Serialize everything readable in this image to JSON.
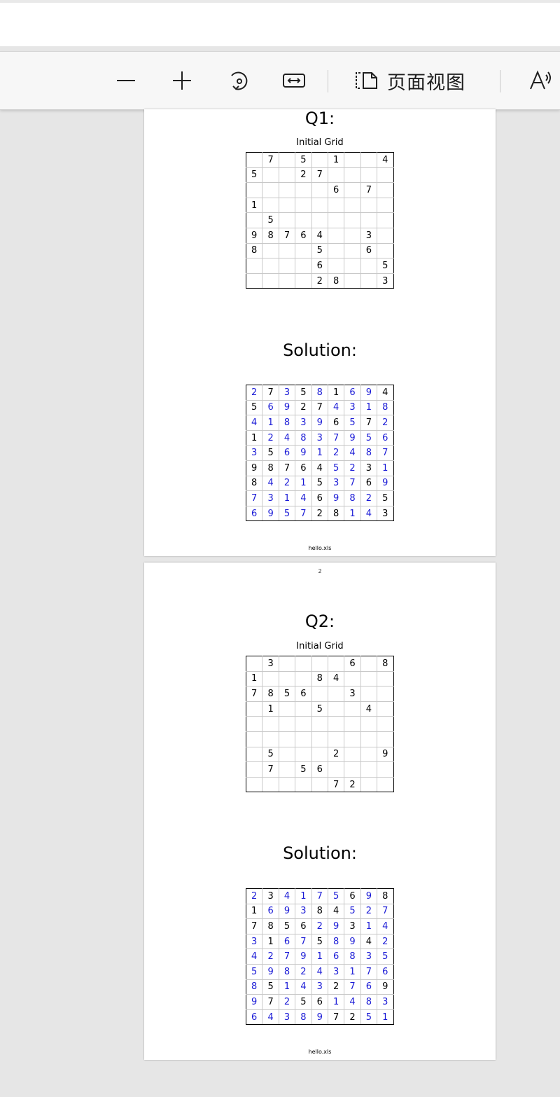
{
  "toolbar": {
    "zoom_out_icon": "minus-icon",
    "zoom_in_icon": "plus-icon",
    "rotate_icon": "rotate-icon",
    "fit_width_icon": "fit-width-icon",
    "page_view_icon": "page-view-icon",
    "page_view_label": "页面视图",
    "read_aloud_icon": "read-aloud-icon"
  },
  "colors": {
    "given": "#000000",
    "solved": "#1a1ad6"
  },
  "pages": [
    {
      "title": "Q1:",
      "grid_label": "Initial Grid",
      "solution_title": "Solution:",
      "footer": "hello.xls",
      "initial": [
        [
          "",
          "7",
          "",
          "5",
          "",
          "1",
          "",
          "",
          "4"
        ],
        [
          "5",
          "",
          "",
          "2",
          "7",
          "",
          "",
          "",
          ""
        ],
        [
          "",
          "",
          "",
          "",
          "",
          "6",
          "",
          "7",
          ""
        ],
        [
          "1",
          "",
          "",
          "",
          "",
          "",
          "",
          "",
          ""
        ],
        [
          "",
          "5",
          "",
          "",
          "",
          "",
          "",
          "",
          ""
        ],
        [
          "9",
          "8",
          "7",
          "6",
          "4",
          "",
          "",
          "3",
          ""
        ],
        [
          "8",
          "",
          "",
          "",
          "5",
          "",
          "",
          "6",
          ""
        ],
        [
          "",
          "",
          "",
          "",
          "6",
          "",
          "",
          "",
          "5"
        ],
        [
          "",
          "",
          "",
          "",
          "2",
          "8",
          "",
          "",
          "3"
        ]
      ],
      "solution": [
        [
          "2",
          "7",
          "3",
          "5",
          "8",
          "1",
          "6",
          "9",
          "4"
        ],
        [
          "5",
          "6",
          "9",
          "2",
          "7",
          "4",
          "3",
          "1",
          "8"
        ],
        [
          "4",
          "1",
          "8",
          "3",
          "9",
          "6",
          "5",
          "7",
          "2"
        ],
        [
          "1",
          "2",
          "4",
          "8",
          "3",
          "7",
          "9",
          "5",
          "6"
        ],
        [
          "3",
          "5",
          "6",
          "9",
          "1",
          "2",
          "4",
          "8",
          "7"
        ],
        [
          "9",
          "8",
          "7",
          "6",
          "4",
          "5",
          "2",
          "3",
          "1"
        ],
        [
          "8",
          "4",
          "2",
          "1",
          "5",
          "3",
          "7",
          "6",
          "9"
        ],
        [
          "7",
          "3",
          "1",
          "4",
          "6",
          "9",
          "8",
          "2",
          "5"
        ],
        [
          "6",
          "9",
          "5",
          "7",
          "2",
          "8",
          "1",
          "4",
          "3"
        ]
      ]
    },
    {
      "page_number": "2",
      "title": "Q2:",
      "grid_label": "Initial Grid",
      "solution_title": "Solution:",
      "footer": "hello.xls",
      "initial": [
        [
          "",
          "3",
          "",
          "",
          "",
          "",
          "6",
          "",
          "8"
        ],
        [
          "1",
          "",
          "",
          "",
          "8",
          "4",
          "",
          "",
          ""
        ],
        [
          "7",
          "8",
          "5",
          "6",
          "",
          "",
          "3",
          "",
          ""
        ],
        [
          "",
          "1",
          "",
          "",
          "5",
          "",
          "",
          "4",
          ""
        ],
        [
          "",
          "",
          "",
          "",
          "",
          "",
          "",
          "",
          ""
        ],
        [
          "",
          "",
          "",
          "",
          "",
          "",
          "",
          "",
          ""
        ],
        [
          "",
          "5",
          "",
          "",
          "",
          "2",
          "",
          "",
          "9"
        ],
        [
          "",
          "7",
          "",
          "5",
          "6",
          "",
          "",
          "",
          ""
        ],
        [
          "",
          "",
          "",
          "",
          "",
          "7",
          "2",
          "",
          ""
        ]
      ],
      "solution": [
        [
          "2",
          "3",
          "4",
          "1",
          "7",
          "5",
          "6",
          "9",
          "8"
        ],
        [
          "1",
          "6",
          "9",
          "3",
          "8",
          "4",
          "5",
          "2",
          "7"
        ],
        [
          "7",
          "8",
          "5",
          "6",
          "2",
          "9",
          "3",
          "1",
          "4"
        ],
        [
          "3",
          "1",
          "6",
          "7",
          "5",
          "8",
          "9",
          "4",
          "2"
        ],
        [
          "4",
          "2",
          "7",
          "9",
          "1",
          "6",
          "8",
          "3",
          "5"
        ],
        [
          "5",
          "9",
          "8",
          "2",
          "4",
          "3",
          "1",
          "7",
          "6"
        ],
        [
          "8",
          "5",
          "1",
          "4",
          "3",
          "2",
          "7",
          "6",
          "9"
        ],
        [
          "9",
          "7",
          "2",
          "5",
          "6",
          "1",
          "4",
          "8",
          "3"
        ],
        [
          "6",
          "4",
          "3",
          "8",
          "9",
          "7",
          "2",
          "5",
          "1"
        ]
      ]
    }
  ]
}
